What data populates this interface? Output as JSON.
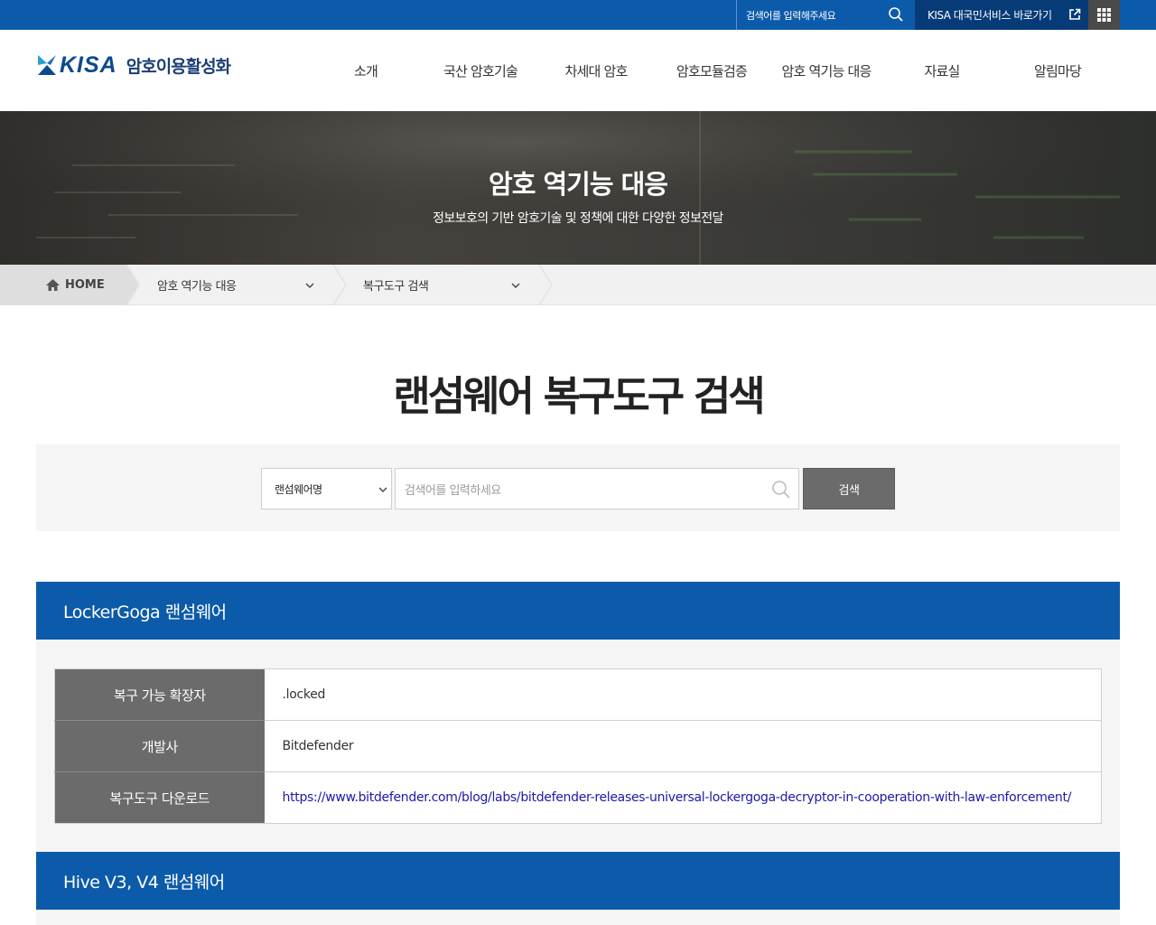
{
  "topbar": {
    "search_placeholder": "검색어를 입력해주세요",
    "link_label": "KISA 대국민서비스 바로가기"
  },
  "header": {
    "logo_text": "KISA",
    "logo_sub": "암호이용활성화",
    "menu": [
      "소개",
      "국산 암호기술",
      "차세대 암호",
      "암호모듈검증",
      "암호 역기능 대응",
      "자료실",
      "알림마당"
    ]
  },
  "visual": {
    "title": "암호 역기능 대응",
    "subtitle": "정보보호의 기반 암호기술 및 정책에 대한 다양한 정보전달"
  },
  "location": {
    "home": "HOME",
    "depth1": "암호 역기능 대응",
    "depth2": "복구도구 검색"
  },
  "page_title": "랜섬웨어 복구도구 검색",
  "search": {
    "select_value": "랜섬웨어명",
    "input_placeholder": "검색어를 입력하세요",
    "button": "검색"
  },
  "results": [
    {
      "title": "LockerGoga 랜섬웨어",
      "rows": [
        {
          "label": "복구 가능 확장자",
          "value": ".locked"
        },
        {
          "label": "개발사",
          "value": "Bitdefender"
        },
        {
          "label": "복구도구 다운로드",
          "value": "https://www.bitdefender.com/blog/labs/bitdefender-releases-universal-lockergoga-decryptor-in-cooperation-with-law-enforcement/"
        }
      ]
    },
    {
      "title": "Hive V3, V4 랜섬웨어"
    }
  ],
  "colors": {
    "primary": "#0c5baa",
    "dark_blue": "#063b78",
    "th_gray": "#6b6b6b",
    "link": "#1a1aa8"
  }
}
